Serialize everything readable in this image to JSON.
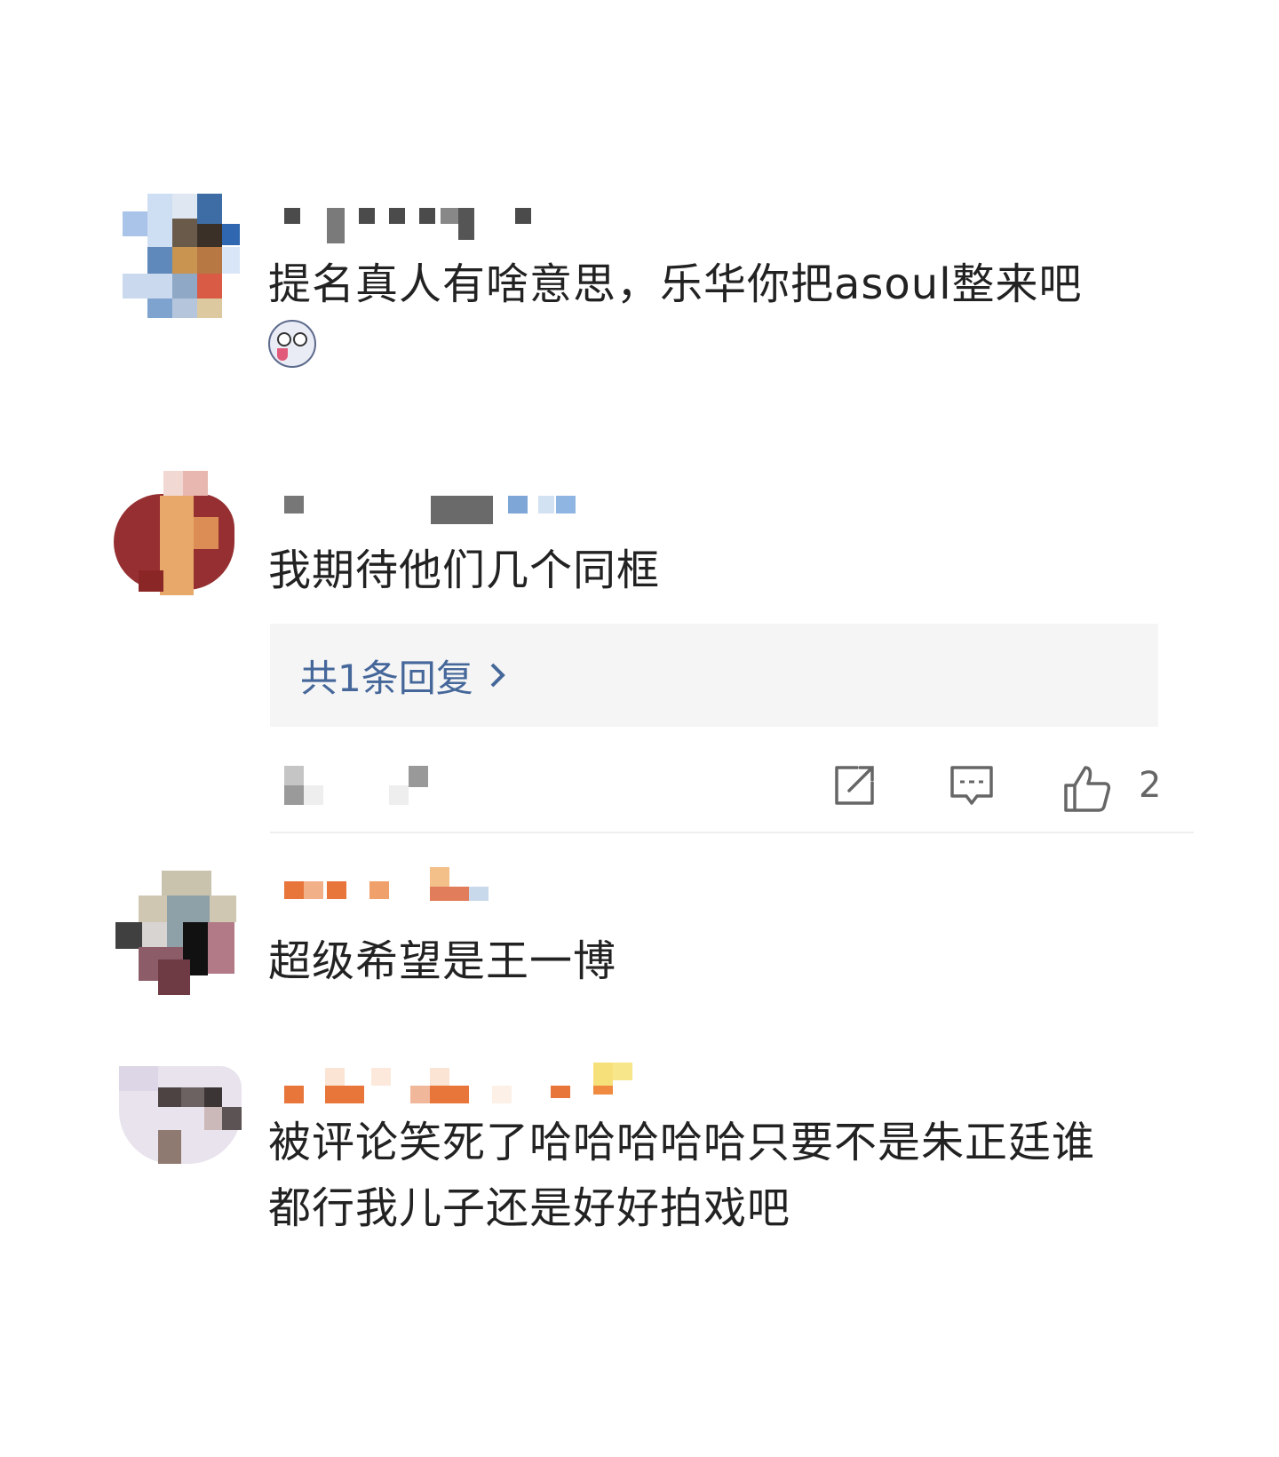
{
  "comments": [
    {
      "text_line1": "提名真人有啥意思，乐华你把asoul整来吧",
      "emoji": "husky-emoji"
    },
    {
      "text_line1": "我期待他们几个同框",
      "replies_label": "共1条回复",
      "like_count": "2"
    },
    {
      "text_line1": "超级希望是王一博"
    },
    {
      "text_line1": "被评论笑死了哈哈哈哈哈只要不是朱正廷谁",
      "text_line2": "都行我儿子还是好好拍戏吧"
    }
  ],
  "icons": {
    "share": "share-icon",
    "comment": "comment-icon",
    "like": "thumbs-up-icon",
    "chevron": "chevron-right-icon"
  },
  "colors": {
    "link": "#45679a",
    "reply_bg": "#f5f5f5"
  }
}
